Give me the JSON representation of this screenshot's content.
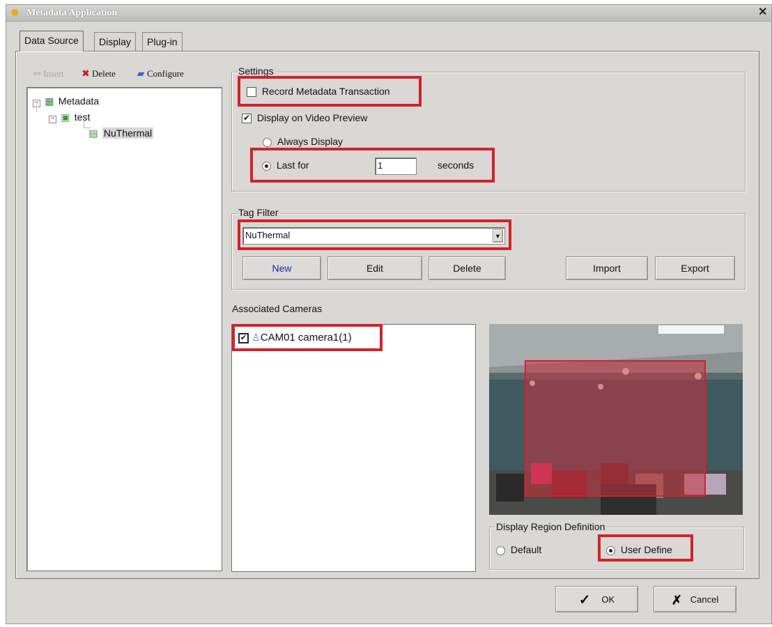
{
  "window": {
    "title": "Metadata Application",
    "close_glyph": "✕"
  },
  "tabs": [
    {
      "label": "Data Source",
      "active": true
    },
    {
      "label": "Display",
      "active": false
    },
    {
      "label": "Plug-in",
      "active": false
    }
  ],
  "toolbar": {
    "insert_label": "Insert",
    "delete_label": "Delete",
    "configure_label": "Configure"
  },
  "tree": {
    "root": "Metadata",
    "child": "test",
    "leaf": "NuThermal"
  },
  "settings": {
    "group_label": "Settings",
    "record_label": "Record Metadata Transaction",
    "record_checked": false,
    "display_preview_label": "Display on Video Preview",
    "display_preview_checked": true,
    "always_display_label": "Always Display",
    "last_for_label": "Last for",
    "last_for_value": "1",
    "seconds_label": "seconds"
  },
  "tag_filter": {
    "group_label": "Tag Filter",
    "selected": "NuThermal",
    "new_label": "New",
    "edit_label": "Edit",
    "delete_label": "Delete",
    "import_label": "Import",
    "export_label": "Export"
  },
  "cameras": {
    "label": "Associated Cameras",
    "items": [
      {
        "name": "CAM01 camera1(1)",
        "checked": true
      }
    ]
  },
  "region": {
    "group_label": "Display Region Definition",
    "default_label": "Default",
    "user_define_label": "User Define",
    "selected": "User Define"
  },
  "footer": {
    "ok_label": "OK",
    "cancel_label": "Cancel"
  },
  "colors": {
    "highlight": "#d2222b",
    "region_overlay": "#c8323f",
    "dialog_bg": "#d9d8d4"
  },
  "icons": [
    "app-icon",
    "insert-icon",
    "delete-icon",
    "configure-icon",
    "metadata-icon",
    "folder-icon",
    "device-icon",
    "camera-icon",
    "checkmark-icon",
    "x-icon",
    "dropdown-arrow-icon"
  ]
}
